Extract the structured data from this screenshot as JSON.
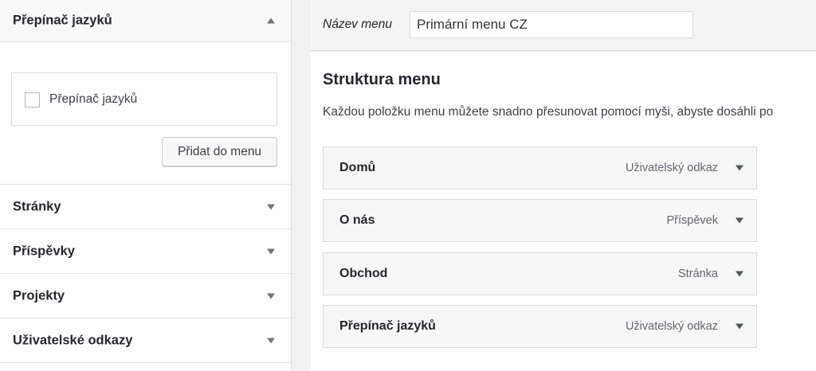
{
  "left_panel": {
    "language_switcher": {
      "title": "Přepínač jazyků",
      "checkbox_label": "Přepínač jazyků",
      "add_button": "Přidat do menu"
    },
    "sections": [
      {
        "title": "Stránky"
      },
      {
        "title": "Příspěvky"
      },
      {
        "title": "Projekty"
      },
      {
        "title": "Uživatelské odkazy"
      }
    ]
  },
  "menu_name": {
    "label": "Název menu",
    "value": "Primární menu CZ"
  },
  "structure": {
    "title": "Struktura menu",
    "description": "Každou položku menu můžete snadno přesunovat pomocí myši, abyste dosáhli po",
    "items": [
      {
        "title": "Domů",
        "type": "Uživatelský odkaz"
      },
      {
        "title": "O nás",
        "type": "Příspěvek"
      },
      {
        "title": "Obchod",
        "type": "Stránka"
      },
      {
        "title": "Přepínač jazyků",
        "type": "Uživatelský odkaz"
      }
    ]
  }
}
